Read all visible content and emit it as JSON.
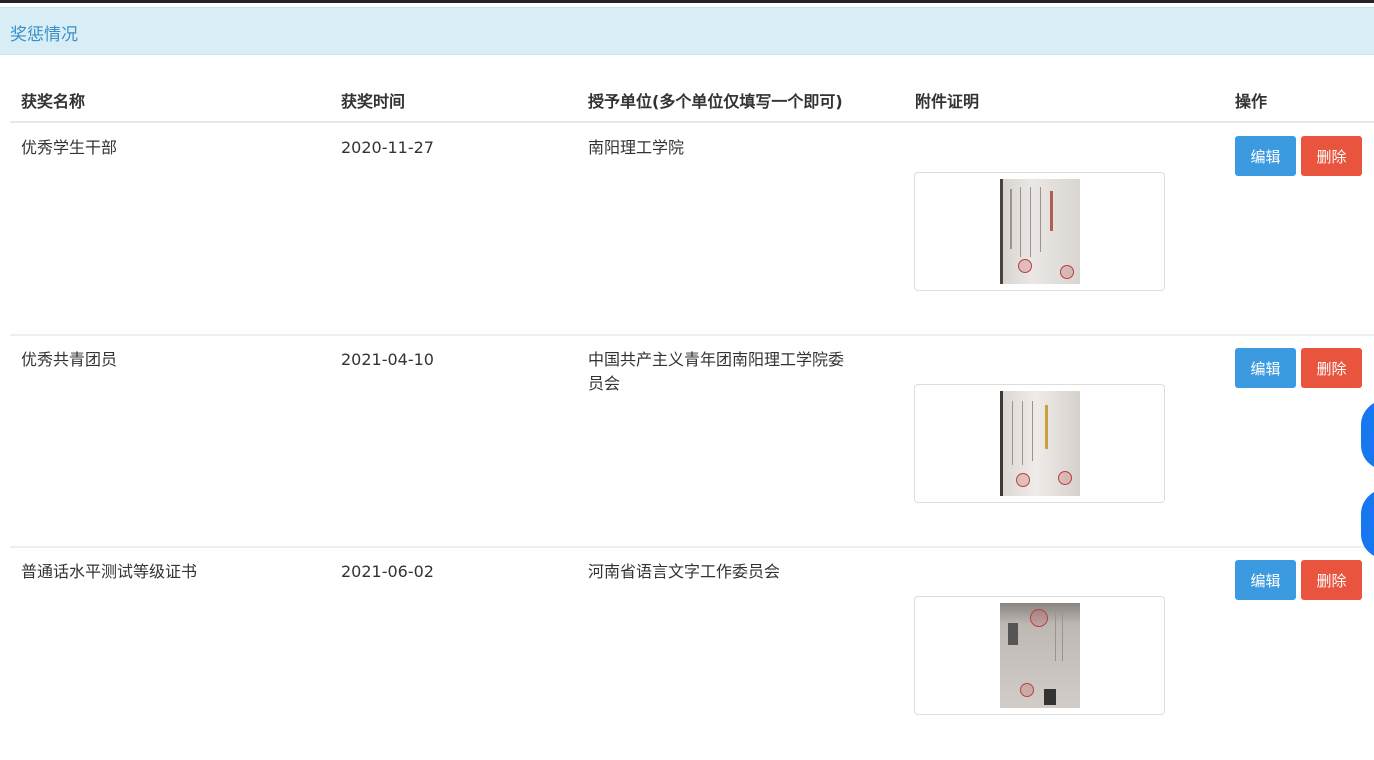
{
  "panel": {
    "title": "奖惩情况"
  },
  "table": {
    "headers": [
      "获奖名称",
      "获奖时间",
      "授予单位(多个单位仅填写一个即可)",
      "附件证明",
      "操作"
    ],
    "rows": [
      {
        "name": "优秀学生干部",
        "date": "2020-11-27",
        "unit": "南阳理工学院",
        "attachment": "certificate-image"
      },
      {
        "name": "优秀共青团员",
        "date": "2021-04-10",
        "unit": "中国共产主义青年团南阳理工学院委员会",
        "attachment": "certificate-image"
      },
      {
        "name": "普通话水平测试等级证书",
        "date": "2021-06-02",
        "unit": "河南省语言文字工作委员会",
        "attachment": "certificate-image"
      }
    ],
    "actions": {
      "edit_label": "编辑",
      "delete_label": "删除"
    }
  },
  "colors": {
    "heading_bg": "#d9edf7",
    "heading_text": "#3a8fc8",
    "edit_button": "#3c9ae0",
    "delete_button": "#e9543e",
    "floating_button": "#1677f0"
  }
}
